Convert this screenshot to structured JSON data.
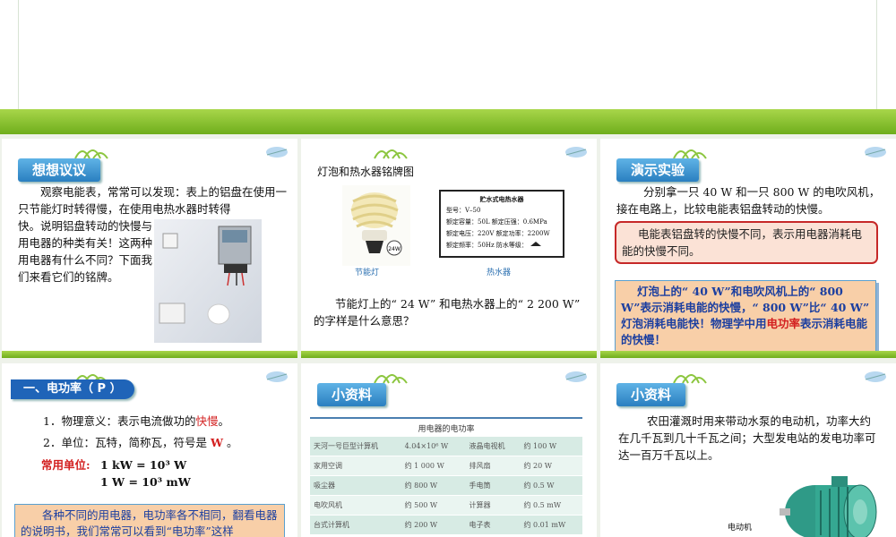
{
  "s1": {
    "tag": "想想议议",
    "text_top": "观察电能表，常常可以发现：表上的铝盘在使用一只节能灯时转得慢，在使用电热水器时转得",
    "text_left": "快。说明铝盘转动的快慢与用电器的种类有关！这两种用电器有什么不同？下面我们来看它们的铭牌。"
  },
  "s2": {
    "title": "灯泡和热水器铭牌图",
    "plate_title": "贮水式电热水器",
    "plate_lines": [
      "型号：V–50",
      "额定容量：50L    额定压强：0.6MPa",
      "额定电压：220V   额定功率：2200W",
      "额定频率：50Hz   防水等级："
    ],
    "bulb_mark": "24W",
    "cap1": "节能灯",
    "cap2": "热水器",
    "q1": "节能灯上的“ 24 W” 和电热水器上的“ 2 200 W”",
    "q2": "的字样是什么意思？"
  },
  "s3": {
    "tag": "演示实验",
    "text": "分别拿一只 40 W 和一只 800 W 的电吹风机，接在电路上，比较电能表铝盘转动的快慢。",
    "redbox": "电能表铝盘转的快慢不同，表示用电器消耗电能的快慢不同。",
    "orbox_a": "灯泡上的“ 40 W”和电吹风机上的“ 800 W”表示消耗电能的快慢，“ 800 W”比“ 40 W” 灯泡消耗电能快！物理学中用",
    "orbox_red": "电功率",
    "orbox_b": "表示消耗电能的快慢！"
  },
  "s4": {
    "tag": "一、电功率（ P ）",
    "l1a": "1．物理意义：表示电流做功的",
    "l1b": "快慢",
    "l1c": "。",
    "l2a": "2．单位：瓦特，简称瓦，符号是",
    "l2b": "W",
    "l2c": "。",
    "unit_label": "常用单位:",
    "u1": "1 kW = 10³ W",
    "u2": "1 W = 10³ mW",
    "box": "各种不同的用电器，电功率各不相同，翻看电器的说明书，我们常常可以看到“电功率”这样"
  },
  "s5": {
    "tag": "小资料",
    "table_title": "用电器的电功率",
    "rows": [
      [
        "天河一号巨型计算机",
        "4.04×10⁶ W",
        "液晶电视机",
        "约 100 W"
      ],
      [
        "家用空调",
        "约 1 000 W",
        "排风扇",
        "约 20 W"
      ],
      [
        "吸尘器",
        "约 800 W",
        "手电筒",
        "约 0.5 W"
      ],
      [
        "电吹风机",
        "约 500 W",
        "计算器",
        "约 0.5 mW"
      ],
      [
        "台式计算机",
        "约 200 W",
        "电子表",
        "约 0.01 mW"
      ]
    ]
  },
  "s6": {
    "tag": "小资料",
    "text": "农田灌溉时用来带动水泵的电动机，功率大约在几千瓦到几十千瓦之间；大型发电站的发电功率可达一百万千瓦以上。",
    "cap": "电动机"
  }
}
